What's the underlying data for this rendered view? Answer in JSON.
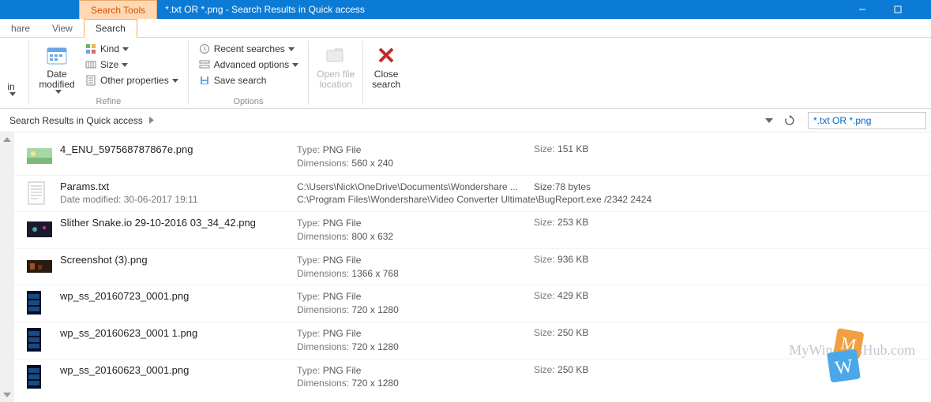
{
  "titlebar": {
    "context_tab": "Search Tools",
    "title": "*.txt OR *.png - Search Results in Quick access"
  },
  "tabs": {
    "share": "hare",
    "view": "View",
    "search": "Search"
  },
  "ribbon": {
    "location_in_label": "in",
    "date_modified_label": "Date\nmodified",
    "kind_label": "Kind",
    "size_label": "Size",
    "other_props_label": "Other properties",
    "refine_group": "Refine",
    "recent_searches_label": "Recent searches",
    "advanced_options_label": "Advanced options",
    "save_search_label": "Save search",
    "options_group": "Options",
    "open_file_location_label": "Open file\nlocation",
    "close_search_label": "Close\nsearch"
  },
  "nav": {
    "breadcrumb": "Search Results in Quick access",
    "search_value": "*.txt OR *.png"
  },
  "results": [
    {
      "thumb": "image-landscape",
      "name": "4_ENU_597568787867e.png",
      "sub_label": "",
      "sub_value": "",
      "meta1_label": "Type:",
      "meta1_value": "PNG File",
      "meta2_label": "Dimensions:",
      "meta2_value": "560 x 240",
      "size_label": "Size:",
      "size_value": "151 KB",
      "extra1": "",
      "extra2": ""
    },
    {
      "thumb": "text-doc",
      "name": "Params.txt",
      "sub_label": "Date modified:",
      "sub_value": "30-06-2017 19:11",
      "meta1_label": "",
      "meta1_value": "C:\\Users\\Nick\\OneDrive\\Documents\\Wondershare ...",
      "meta2_label": "",
      "meta2_value": "C:\\Program Files\\Wondershare\\Video Converter Ultimate\\BugReport.exe /2342 2424",
      "size_label": "Size:",
      "size_value": "78 bytes",
      "extra1": "",
      "extra2": "",
      "wide": true
    },
    {
      "thumb": "image-dark",
      "name": "Slither Snake.io 29-10-2016 03_34_42.png",
      "sub_label": "",
      "sub_value": "",
      "meta1_label": "Type:",
      "meta1_value": "PNG File",
      "meta2_label": "Dimensions:",
      "meta2_value": "800 x 632",
      "size_label": "Size:",
      "size_value": "253 KB",
      "extra1": "",
      "extra2": ""
    },
    {
      "thumb": "image-dark2",
      "name": "Screenshot (3).png",
      "sub_label": "",
      "sub_value": "",
      "meta1_label": "Type:",
      "meta1_value": "PNG File",
      "meta2_label": "Dimensions:",
      "meta2_value": "1366 x 768",
      "size_label": "Size:",
      "size_value": "936 KB",
      "extra1": "",
      "extra2": ""
    },
    {
      "thumb": "image-portrait",
      "name": "wp_ss_20160723_0001.png",
      "sub_label": "",
      "sub_value": "",
      "meta1_label": "Type:",
      "meta1_value": "PNG File",
      "meta2_label": "Dimensions:",
      "meta2_value": "720 x 1280",
      "size_label": "Size:",
      "size_value": "429 KB",
      "extra1": "",
      "extra2": ""
    },
    {
      "thumb": "image-portrait",
      "name": "wp_ss_20160623_0001 1.png",
      "sub_label": "",
      "sub_value": "",
      "meta1_label": "Type:",
      "meta1_value": "PNG File",
      "meta2_label": "Dimensions:",
      "meta2_value": "720 x 1280",
      "size_label": "Size:",
      "size_value": "250 KB",
      "extra1": "",
      "extra2": ""
    },
    {
      "thumb": "image-portrait",
      "name": "wp_ss_20160623_0001.png",
      "sub_label": "",
      "sub_value": "",
      "meta1_label": "Type:",
      "meta1_value": "PNG File",
      "meta2_label": "Dimensions:",
      "meta2_value": "720 x 1280",
      "size_label": "Size:",
      "size_value": "250 KB",
      "extra1": "",
      "extra2": ""
    }
  ],
  "watermark": "MyWindowsHub.com"
}
